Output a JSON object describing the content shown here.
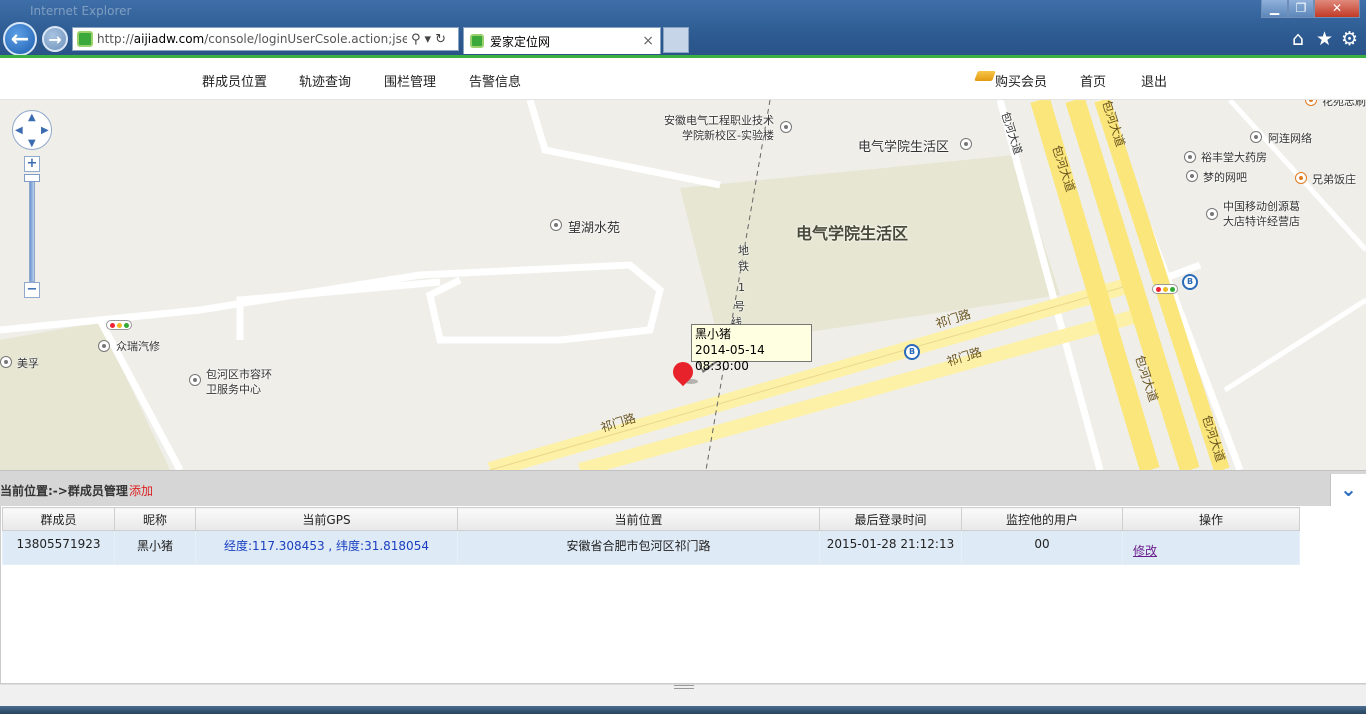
{
  "browser": {
    "window_title": "Internet Explorer",
    "url_scheme": "http://",
    "url_domain": "aijiadw.com",
    "url_path": "/console/loginUserCsole.action;jses",
    "tab_title": "爱家定位网",
    "tab_close": "×",
    "controls": {
      "search": "⚲",
      "dropdown": "▾",
      "refresh": "↻",
      "minimize": "▁",
      "maximize": "❐",
      "close": "✕",
      "home": "⌂",
      "favorites": "★",
      "tools": "⚙"
    }
  },
  "site_nav": {
    "items": [
      "群成员位置",
      "轨迹查询",
      "围栏管理",
      "告警信息"
    ],
    "vip": "购买会员",
    "home": "首页",
    "logout": "退出"
  },
  "map": {
    "controls": {
      "zoom_in": "+",
      "zoom_out": "−",
      "pan_up": "▲",
      "pan_down": "▼",
      "pan_left": "◀",
      "pan_right": "▶"
    },
    "labels": {
      "school_1": "安徽电气工程职业技术",
      "school_2": "学院新校区-实验楼",
      "district_small": "电气学院生活区",
      "district_big": "电气学院生活区",
      "wanghu": "望湖水苑",
      "metro_1": "地",
      "metro_2": "铁",
      "metro_3": "1",
      "metro_4": "号",
      "metro_5": "线",
      "zhongrui": "众瑞汽修",
      "meifu": "美孚",
      "baohe_1": "包河区市容环",
      "baohe_2": "卫服务中心",
      "alian": "阿连网络",
      "yufeng": "裕丰堂大药房",
      "mengde": "梦的网吧",
      "xiongdi": "兄弟饭庄",
      "cmcc_1": "中国移动创源葛",
      "cmcc_2": "大店特许经营店",
      "huayuan": "花苑忠刷"
    },
    "roads": {
      "qimen": "祁门路",
      "baohe_ave": "包河大道",
      "baohe_ave_v": "包河大道"
    },
    "marker": {
      "name": "黑小猪",
      "time": "2014-05-14 08:30:00"
    }
  },
  "panel": {
    "breadcrumb": "当前位置:->群成员管理",
    "add": "添加",
    "collapse_icon": "⌄",
    "columns": [
      "群成员",
      "昵称",
      "当前GPS",
      "当前位置",
      "最后登录时间",
      "监控他的用户",
      "操作"
    ],
    "rows": [
      {
        "member": "13805571923",
        "nickname": "黑小猪",
        "gps": "经度:117.308453 , 纬度:31.818054",
        "location": "安徽省合肥市包河区祁门路",
        "last_login": "2015-01-28 21:12:13",
        "watchers": "00",
        "action": "修改"
      }
    ]
  }
}
